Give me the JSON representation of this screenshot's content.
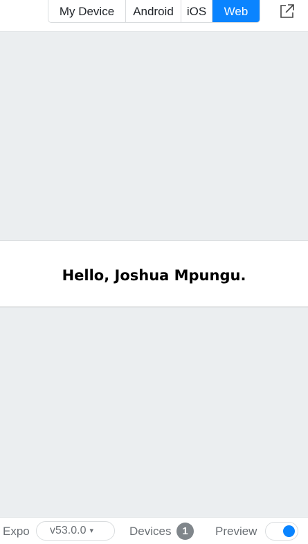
{
  "topbar": {
    "tabs": [
      {
        "label": "My Device",
        "active": false
      },
      {
        "label": "Android",
        "active": false
      },
      {
        "label": "iOS",
        "active": false
      },
      {
        "label": "Web",
        "active": true
      }
    ],
    "open_external_icon": "open-external-icon"
  },
  "preview": {
    "greeting": "Hello, Joshua Mpungu."
  },
  "bottombar": {
    "expo_label": "Expo",
    "version": "v53.0.0",
    "version_caret": "▾",
    "devices_label": "Devices",
    "devices_count": "1",
    "preview_label": "Preview",
    "preview_enabled": true
  },
  "colors": {
    "accent": "#0a84ff",
    "preview_background": "#ebeef0",
    "badge": "#80868b"
  }
}
